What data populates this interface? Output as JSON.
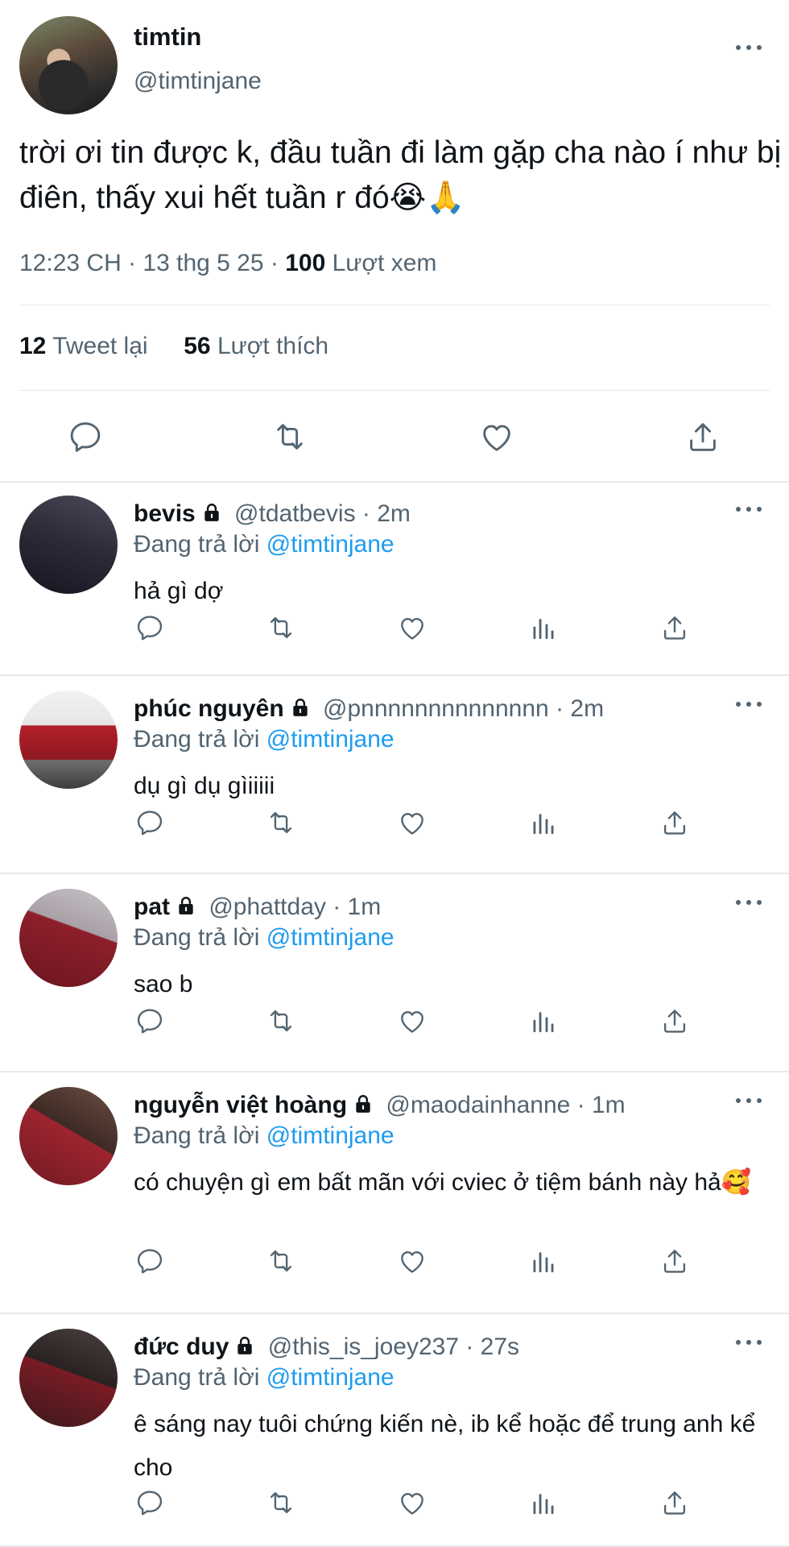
{
  "main": {
    "name": "timtin",
    "handle": "@timtinjane",
    "text": "trời ơi tin được k, đầu tuần đi làm gặp cha nào í như bị điên, thấy xui hết tuần r đó😭🙏",
    "time": "12:23 CH · 13 thg 5 25 · ",
    "views_count": "100",
    "views_label": " Lượt xem",
    "retweets_count": "12",
    "retweets_label": " Tweet lại",
    "likes_count": "56",
    "likes_label": " Lượt thích",
    "icons": [
      "reply-icon",
      "retweet-icon",
      "like-icon",
      "share-icon"
    ]
  },
  "replying_prefix": "Đang trả lời ",
  "replies": [
    {
      "name": "bevis",
      "handle": " @tdatbevis · 2m",
      "mention": "@timtinjane",
      "text": "hả gì dợ"
    },
    {
      "name": "phúc nguyên",
      "handle": " @pnnnnnnnnnnnnnn · 2m",
      "mention": "@timtinjane",
      "text": "dụ gì dụ gìiiiii"
    },
    {
      "name": "pat",
      "handle": " @phattday · 1m",
      "mention": "@timtinjane",
      "text": "sao b"
    },
    {
      "name": "nguyễn việt hoàng",
      "handle": " @maodainhanne · 1m",
      "mention": "@timtinjane",
      "text": "có chuyện gì em bất mãn với cviec ở tiệm bánh này hả🥰"
    },
    {
      "name": "đức duy",
      "handle": " @this_is_joey237 · 27s",
      "mention": "@timtinjane",
      "text": "ê sáng nay tuôi chứng kiến nè, ib kể hoặc để trung anh kể cho"
    }
  ],
  "colors": {
    "text": "#0f1419",
    "muted": "#536471",
    "link": "#1d9bf0",
    "divider": "#e6e9ec"
  }
}
